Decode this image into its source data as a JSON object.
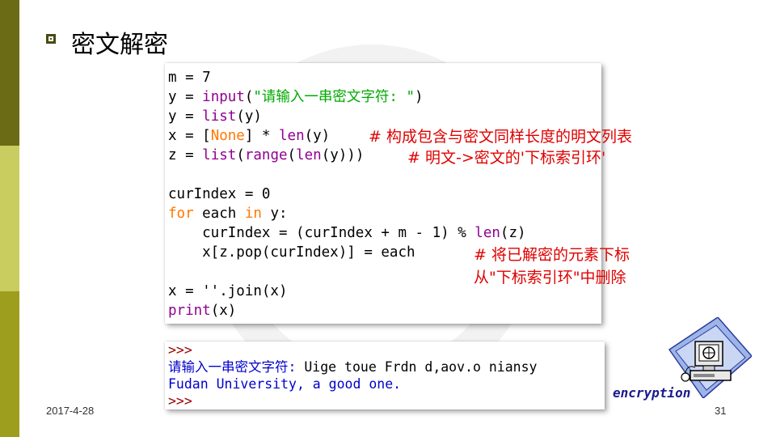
{
  "title": "密文解密",
  "code": {
    "l1": "m = 7",
    "l2_pre": "y = ",
    "l2_fn": "input",
    "l2_paren_open": "(",
    "l2_str": "\"请输入一串密文字符: \"",
    "l2_paren_close": ")",
    "l3_pre": "y = ",
    "l3_fn": "list",
    "l3_post": "(y)",
    "l4_pre": "x = [",
    "l4_none": "None",
    "l4_mid": "] * ",
    "l4_fn": "len",
    "l4_post": "(y)",
    "l5_pre": "z = ",
    "l5_fn1": "list",
    "l5_p1": "(",
    "l5_fn2": "range",
    "l5_p2": "(",
    "l5_fn3": "len",
    "l5_post": "(y)))",
    "l6": "curIndex = 0",
    "l7_for": "for",
    "l7_mid": " each ",
    "l7_in": "in",
    "l7_post": " y:",
    "l8_pre": "    curIndex = (curIndex + m - 1) % ",
    "l8_fn": "len",
    "l8_post": "(z)",
    "l9": "    x[z.pop(curIndex)] = each",
    "l10": "x = ''.join(x)",
    "l11_fn": "print",
    "l11_post": "(x)"
  },
  "comments": {
    "c1": "# 构成包含与密文同样长度的明文列表",
    "c2": "# 明文->密文的'下标索引环'",
    "c3a": "# 将已解密的元素下标",
    "c3b": "从\"下标索引环\"中删除"
  },
  "shell": {
    "prompt1": ">>>",
    "input_prompt": "请输入一串密文字符: ",
    "input_value": "Uige toue Frdn d,aov.o niansy",
    "output": "Fudan University, a good one.",
    "prompt2": ">>>"
  },
  "image_label": "encryption",
  "footer": {
    "date": "2017-4-28",
    "page": "31"
  },
  "colors": {
    "keyword": "#ff7700",
    "builtin": "#900090",
    "string": "#00aa00",
    "comment": "#e00000",
    "shell_prompt": "#990000",
    "shell_output": "#0000cc"
  },
  "icons": [
    "bullet-square-icon",
    "computer-icon"
  ]
}
